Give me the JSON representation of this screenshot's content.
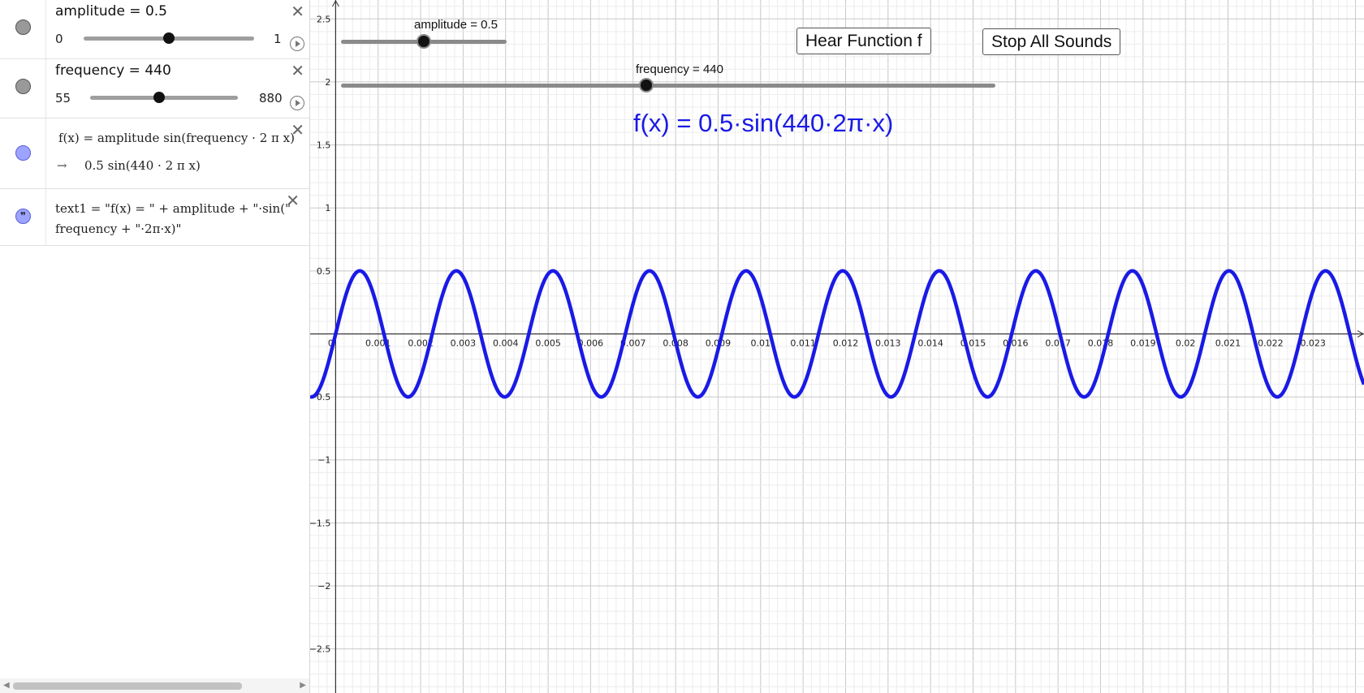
{
  "algebra": {
    "amplitude": {
      "label": "amplitude = 0.5",
      "min": "0",
      "max": "1",
      "value": 0.5,
      "min_value": 0,
      "max_value": 1
    },
    "frequency": {
      "label": "frequency = 440",
      "min": "55",
      "max": "880",
      "value": 440,
      "min_value": 55,
      "max_value": 880
    },
    "function": {
      "definition": "f(x) = amplitude  sin(frequency · 2 π x)",
      "arrow": "→",
      "result": "0.5  sin(440 · 2 π x)"
    },
    "text": {
      "line1": "text1 = \"f(x) = \" + amplitude + \"·sin(\"",
      "line2": "frequency + \"·2π·x)\""
    },
    "close_glyph": "✕",
    "colors": {
      "function": "#1a1ae6",
      "marble_gray": "#999999",
      "marble_blue": "#9da4ff"
    }
  },
  "graph": {
    "buttons": {
      "hear": "Hear Function f",
      "stop": "Stop All Sounds"
    },
    "sliders": {
      "amplitude": {
        "label": "amplitude = 0.5",
        "value": 0.5,
        "min": 0,
        "max": 1
      },
      "frequency": {
        "label": "frequency = 440",
        "value": 440,
        "min": 55,
        "max": 880
      }
    },
    "formula": "f(x) = 0.5·sin(440·2π·x)"
  },
  "chart_data": {
    "type": "line",
    "function": "0.5·sin(440·2π·x)",
    "amplitude": 0.5,
    "frequency": 440,
    "xlim": [
      -0.0006,
      0.0242
    ],
    "ylim": [
      -2.85,
      2.65
    ],
    "x_ticks": [
      "0",
      "0.001",
      "0.002",
      "0.003",
      "0.004",
      "0.005",
      "0.006",
      "0.007",
      "0.008",
      "0.009",
      "0.01",
      "0.011",
      "0.012",
      "0.013",
      "0.014",
      "0.015",
      "0.016",
      "0.017",
      "0.018",
      "0.019",
      "0.02",
      "0.021",
      "0.022",
      "0.023"
    ],
    "y_ticks": [
      "2.5",
      "2",
      "1.5",
      "1",
      "0.5",
      "−0.5",
      "−1",
      "−1.5",
      "−2",
      "−2.5"
    ],
    "grid": true,
    "color": "#1a1ae6"
  }
}
